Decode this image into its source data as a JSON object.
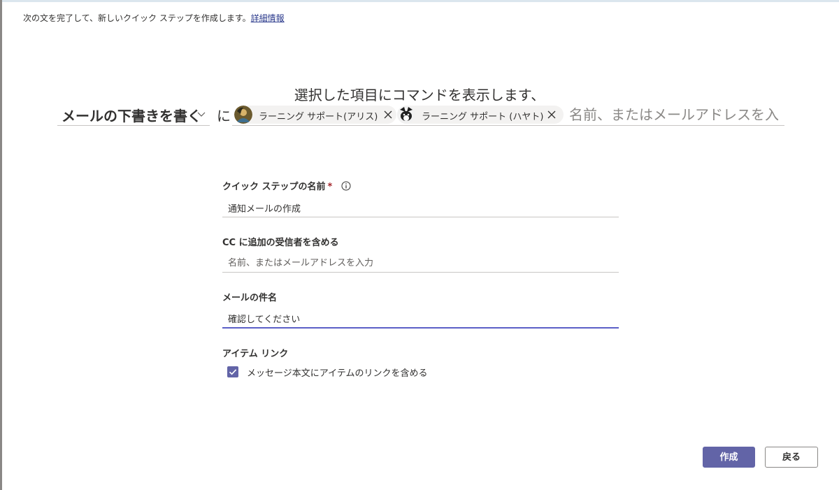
{
  "intro": {
    "text": "次の文を完了して、新しいクイック ステップを作成します。",
    "link": "詳細情報"
  },
  "command": {
    "heading": "選択した項目にコマンドを表示します、",
    "action": "メールの下書きを書く",
    "particle": "に",
    "recipients": [
      {
        "name": "ラーニング サポート(アリス)",
        "avatar": "avatar-alice"
      },
      {
        "name": "ラーニング サポート (ハヤト)",
        "avatar": "avatar-hayato"
      }
    ],
    "to_placeholder": "名前、またはメールアドレスを入力"
  },
  "form": {
    "name": {
      "label": "クイック ステップの名前",
      "required_mark": "*",
      "value": "通知メールの作成"
    },
    "cc": {
      "label": "CC に追加の受信者を含める",
      "placeholder": "名前、またはメールアドレスを入力"
    },
    "subject": {
      "label": "メールの件名",
      "value": "確認してください"
    },
    "item_link": {
      "label": "アイテム リンク",
      "checkbox_label": "メッセージ本文にアイテムのリンクを含める",
      "checked": true
    }
  },
  "buttons": {
    "create": "作成",
    "back": "戻る"
  },
  "colors": {
    "accent": "#6264a7",
    "focus_underline": "#5b5fc7",
    "required": "#a4262c"
  }
}
